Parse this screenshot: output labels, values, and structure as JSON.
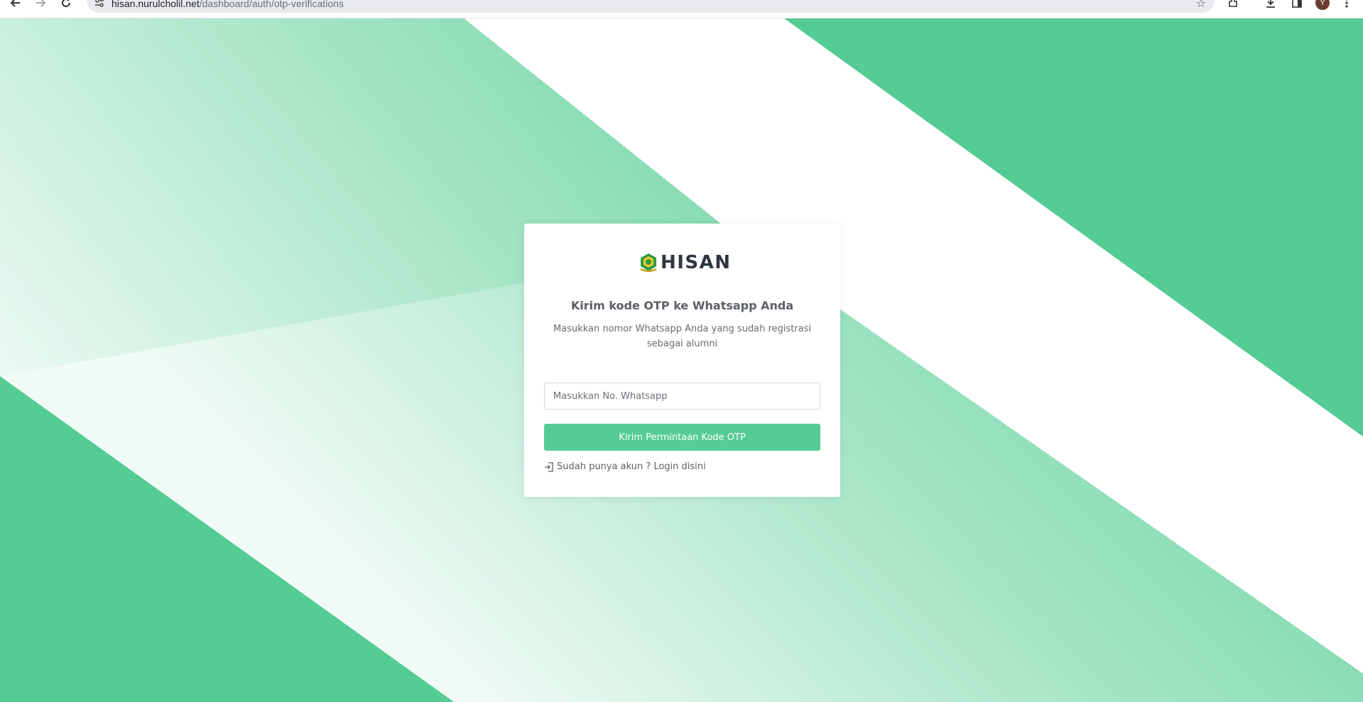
{
  "browser": {
    "url_host": "hisan.nurulcholil.net",
    "url_path": "/dashboard/auth/otp-verifications",
    "avatar_letter": "Y"
  },
  "brand": {
    "name": "HISAN",
    "primary": "#54cc94",
    "dark_text": "#2f3541"
  },
  "card": {
    "title": "Kirim kode OTP ke Whatsapp Anda",
    "subtitle": "Masukkan nomor Whatsapp Anda yang sudah registrasi sebagai alumni",
    "phone_placeholder": "Masukkan No. Whatsapp",
    "phone_value": "",
    "submit_label": "Kirim Permintaan Kode OTP",
    "login_link_label": "Sudah punya akun ? Login disini",
    "login_icon": "sign-in-icon"
  }
}
